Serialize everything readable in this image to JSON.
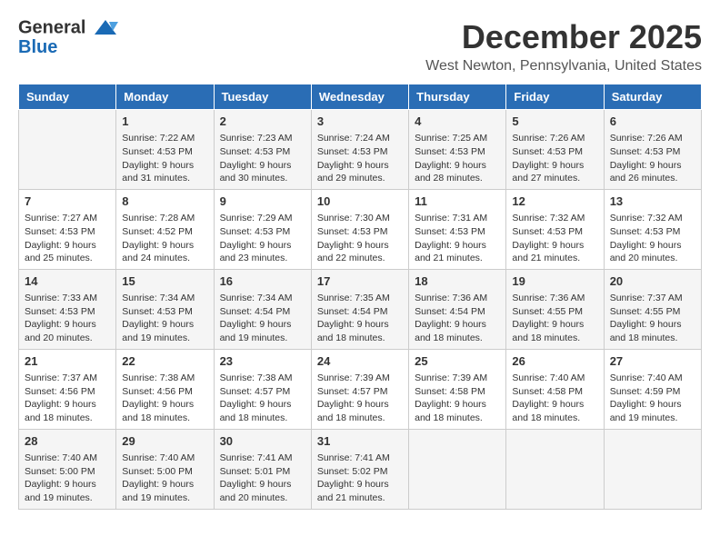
{
  "header": {
    "logo_line1": "General",
    "logo_line2": "Blue",
    "month": "December 2025",
    "location": "West Newton, Pennsylvania, United States"
  },
  "days_of_week": [
    "Sunday",
    "Monday",
    "Tuesday",
    "Wednesday",
    "Thursday",
    "Friday",
    "Saturday"
  ],
  "weeks": [
    [
      {
        "day": "",
        "info": ""
      },
      {
        "day": "1",
        "info": "Sunrise: 7:22 AM\nSunset: 4:53 PM\nDaylight: 9 hours\nand 31 minutes."
      },
      {
        "day": "2",
        "info": "Sunrise: 7:23 AM\nSunset: 4:53 PM\nDaylight: 9 hours\nand 30 minutes."
      },
      {
        "day": "3",
        "info": "Sunrise: 7:24 AM\nSunset: 4:53 PM\nDaylight: 9 hours\nand 29 minutes."
      },
      {
        "day": "4",
        "info": "Sunrise: 7:25 AM\nSunset: 4:53 PM\nDaylight: 9 hours\nand 28 minutes."
      },
      {
        "day": "5",
        "info": "Sunrise: 7:26 AM\nSunset: 4:53 PM\nDaylight: 9 hours\nand 27 minutes."
      },
      {
        "day": "6",
        "info": "Sunrise: 7:26 AM\nSunset: 4:53 PM\nDaylight: 9 hours\nand 26 minutes."
      }
    ],
    [
      {
        "day": "7",
        "info": "Sunrise: 7:27 AM\nSunset: 4:53 PM\nDaylight: 9 hours\nand 25 minutes."
      },
      {
        "day": "8",
        "info": "Sunrise: 7:28 AM\nSunset: 4:52 PM\nDaylight: 9 hours\nand 24 minutes."
      },
      {
        "day": "9",
        "info": "Sunrise: 7:29 AM\nSunset: 4:53 PM\nDaylight: 9 hours\nand 23 minutes."
      },
      {
        "day": "10",
        "info": "Sunrise: 7:30 AM\nSunset: 4:53 PM\nDaylight: 9 hours\nand 22 minutes."
      },
      {
        "day": "11",
        "info": "Sunrise: 7:31 AM\nSunset: 4:53 PM\nDaylight: 9 hours\nand 21 minutes."
      },
      {
        "day": "12",
        "info": "Sunrise: 7:32 AM\nSunset: 4:53 PM\nDaylight: 9 hours\nand 21 minutes."
      },
      {
        "day": "13",
        "info": "Sunrise: 7:32 AM\nSunset: 4:53 PM\nDaylight: 9 hours\nand 20 minutes."
      }
    ],
    [
      {
        "day": "14",
        "info": "Sunrise: 7:33 AM\nSunset: 4:53 PM\nDaylight: 9 hours\nand 20 minutes."
      },
      {
        "day": "15",
        "info": "Sunrise: 7:34 AM\nSunset: 4:53 PM\nDaylight: 9 hours\nand 19 minutes."
      },
      {
        "day": "16",
        "info": "Sunrise: 7:34 AM\nSunset: 4:54 PM\nDaylight: 9 hours\nand 19 minutes."
      },
      {
        "day": "17",
        "info": "Sunrise: 7:35 AM\nSunset: 4:54 PM\nDaylight: 9 hours\nand 18 minutes."
      },
      {
        "day": "18",
        "info": "Sunrise: 7:36 AM\nSunset: 4:54 PM\nDaylight: 9 hours\nand 18 minutes."
      },
      {
        "day": "19",
        "info": "Sunrise: 7:36 AM\nSunset: 4:55 PM\nDaylight: 9 hours\nand 18 minutes."
      },
      {
        "day": "20",
        "info": "Sunrise: 7:37 AM\nSunset: 4:55 PM\nDaylight: 9 hours\nand 18 minutes."
      }
    ],
    [
      {
        "day": "21",
        "info": "Sunrise: 7:37 AM\nSunset: 4:56 PM\nDaylight: 9 hours\nand 18 minutes."
      },
      {
        "day": "22",
        "info": "Sunrise: 7:38 AM\nSunset: 4:56 PM\nDaylight: 9 hours\nand 18 minutes."
      },
      {
        "day": "23",
        "info": "Sunrise: 7:38 AM\nSunset: 4:57 PM\nDaylight: 9 hours\nand 18 minutes."
      },
      {
        "day": "24",
        "info": "Sunrise: 7:39 AM\nSunset: 4:57 PM\nDaylight: 9 hours\nand 18 minutes."
      },
      {
        "day": "25",
        "info": "Sunrise: 7:39 AM\nSunset: 4:58 PM\nDaylight: 9 hours\nand 18 minutes."
      },
      {
        "day": "26",
        "info": "Sunrise: 7:40 AM\nSunset: 4:58 PM\nDaylight: 9 hours\nand 18 minutes."
      },
      {
        "day": "27",
        "info": "Sunrise: 7:40 AM\nSunset: 4:59 PM\nDaylight: 9 hours\nand 19 minutes."
      }
    ],
    [
      {
        "day": "28",
        "info": "Sunrise: 7:40 AM\nSunset: 5:00 PM\nDaylight: 9 hours\nand 19 minutes."
      },
      {
        "day": "29",
        "info": "Sunrise: 7:40 AM\nSunset: 5:00 PM\nDaylight: 9 hours\nand 19 minutes."
      },
      {
        "day": "30",
        "info": "Sunrise: 7:41 AM\nSunset: 5:01 PM\nDaylight: 9 hours\nand 20 minutes."
      },
      {
        "day": "31",
        "info": "Sunrise: 7:41 AM\nSunset: 5:02 PM\nDaylight: 9 hours\nand 21 minutes."
      },
      {
        "day": "",
        "info": ""
      },
      {
        "day": "",
        "info": ""
      },
      {
        "day": "",
        "info": ""
      }
    ]
  ]
}
